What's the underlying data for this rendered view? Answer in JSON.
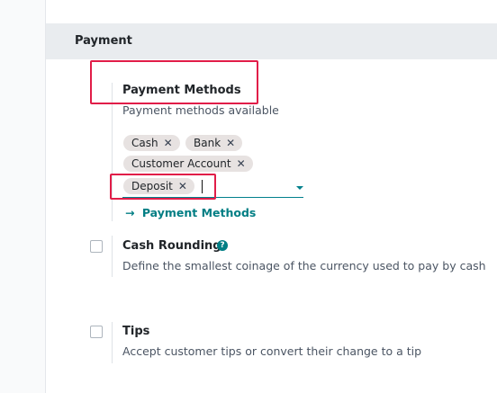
{
  "section": {
    "title": "Payment"
  },
  "payment_methods": {
    "title": "Payment Methods",
    "description": "Payment methods available",
    "tags": [
      "Cash",
      "Bank",
      "Customer Account",
      "Deposit"
    ],
    "link_label": "Payment Methods",
    "link_icon": "→"
  },
  "cash_rounding": {
    "title": "Cash Rounding",
    "description": "Define the smallest coinage of the currency used to pay by cash",
    "help_icon": "?"
  },
  "tips": {
    "title": "Tips",
    "description": "Accept customer tips or convert their change to a tip"
  },
  "colors": {
    "accent": "#017e84",
    "highlight": "#e11d48"
  }
}
